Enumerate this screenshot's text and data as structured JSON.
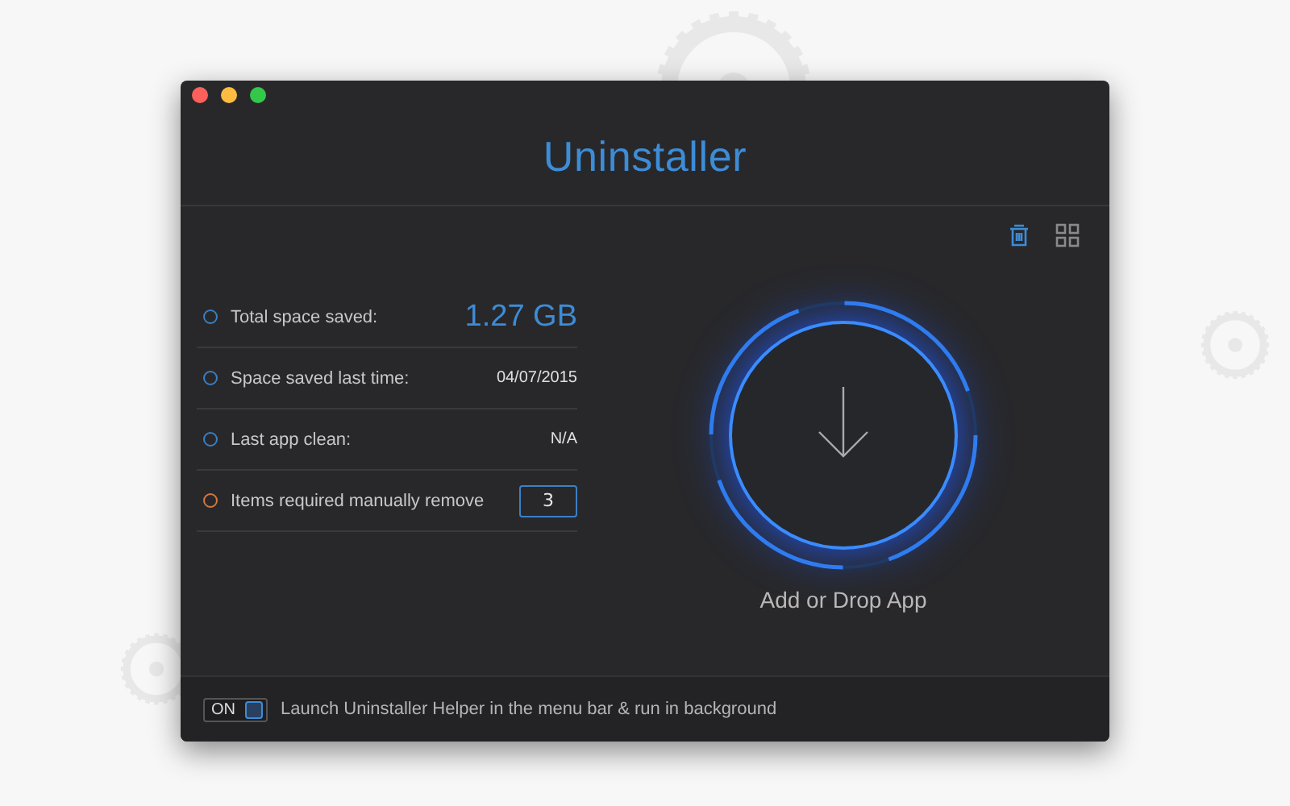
{
  "window": {
    "title": "Uninstaller"
  },
  "view_buttons": [
    {
      "kind": "trash",
      "selected": true
    },
    {
      "kind": "grid",
      "selected": false
    }
  ],
  "stats": [
    {
      "label": "Total space saved:",
      "value": "1.27 GB",
      "kind": "large",
      "color": "#3a7fc1"
    },
    {
      "label": "Space saved last time:",
      "value": "04/07/2015",
      "kind": "plain",
      "color": "#3a7fc1"
    },
    {
      "label": "Last app clean:",
      "value": "N/A",
      "kind": "plain",
      "color": "#3a7fc1"
    },
    {
      "label": "Items required manually remove",
      "value": "3",
      "kind": "boxed",
      "color": "#d9773a"
    }
  ],
  "drop_zone": {
    "label": "Add or Drop App"
  },
  "footer": {
    "toggle": {
      "label": "ON",
      "on": true
    },
    "text": "Launch Uninstaller Helper in the menu bar & run in background"
  }
}
